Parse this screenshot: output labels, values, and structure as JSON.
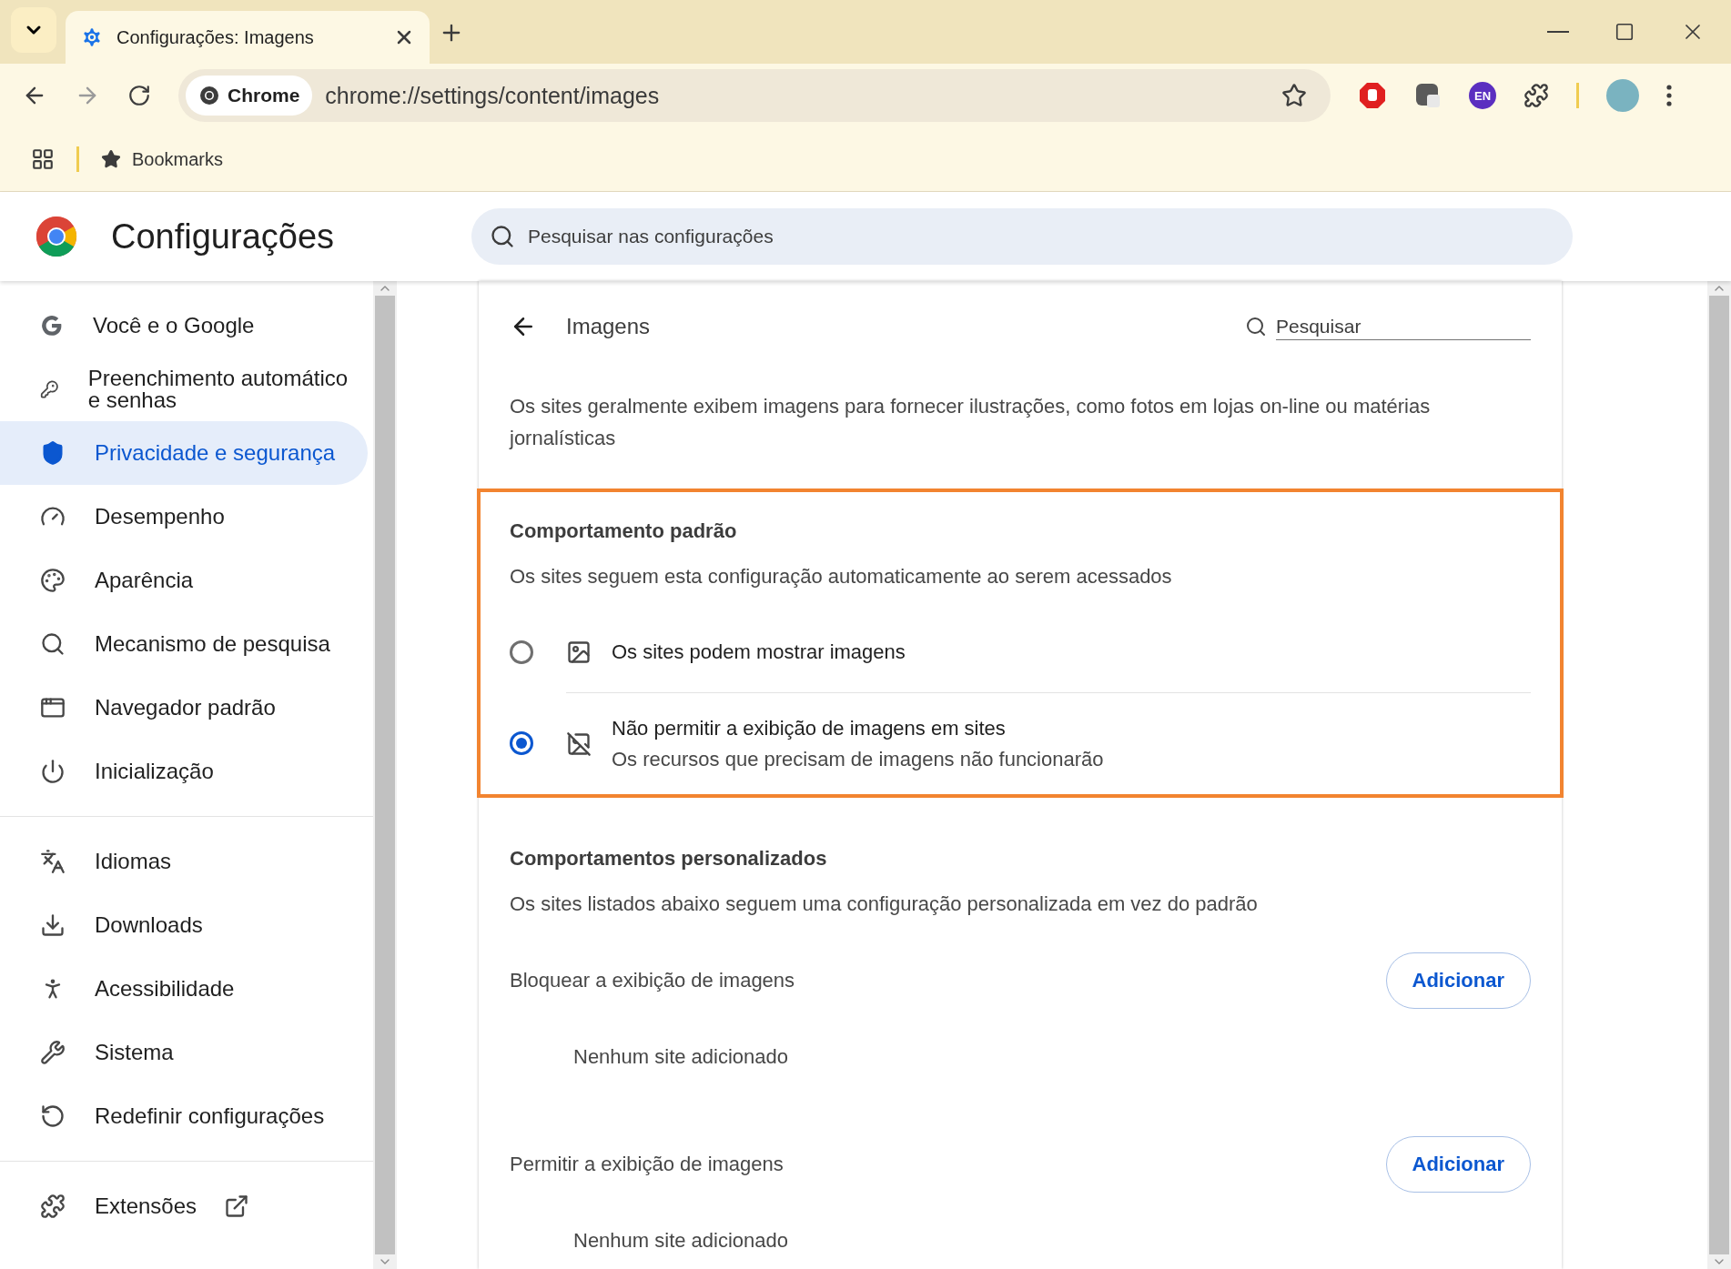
{
  "browser": {
    "tabs": [
      {
        "title": "Configurações: Imagens",
        "selected": true
      }
    ],
    "chip": "Chrome",
    "url": "chrome://settings/content/images",
    "extension_badge": "EN",
    "bookmarks": [
      "Bookmarks"
    ]
  },
  "header": {
    "title": "Configurações",
    "search_placeholder": "Pesquisar nas configurações"
  },
  "sidebar": {
    "groups": [
      [
        {
          "label": "Você e o Google",
          "selected": false
        },
        {
          "label": "Preenchimento automático e senhas",
          "selected": false
        },
        {
          "label": "Privacidade e segurança",
          "selected": true
        },
        {
          "label": "Desempenho",
          "selected": false
        },
        {
          "label": "Aparência",
          "selected": false
        },
        {
          "label": "Mecanismo de pesquisa",
          "selected": false
        },
        {
          "label": "Navegador padrão",
          "selected": false
        },
        {
          "label": "Inicialização",
          "selected": false
        }
      ],
      [
        {
          "label": "Idiomas",
          "selected": false
        },
        {
          "label": "Downloads",
          "selected": false
        },
        {
          "label": "Acessibilidade",
          "selected": false
        },
        {
          "label": "Sistema",
          "selected": false
        },
        {
          "label": "Redefinir configurações",
          "selected": false
        }
      ],
      [
        {
          "label": "Extensões",
          "selected": false,
          "external": true
        }
      ]
    ]
  },
  "page": {
    "title": "Imagens",
    "search_placeholder": "Pesquisar",
    "description": "Os sites geralmente exibem imagens para fornecer ilustrações, como fotos em lojas on-line ou matérias jornalísticas",
    "default_behavior": {
      "heading": "Comportamento padrão",
      "description": "Os sites seguem esta configuração automaticamente ao serem acessados",
      "highlighted": true,
      "options": [
        {
          "label": "Os sites podem mostrar imagens",
          "selected": false
        },
        {
          "label": "Não permitir a exibição de imagens em sites",
          "sublabel": "Os recursos que precisam de imagens não funcionarão",
          "selected": true
        }
      ]
    },
    "custom_behavior": {
      "heading": "Comportamentos personalizados",
      "description": "Os sites listados abaixo seguem uma configuração personalizada em vez do padrão",
      "sections": [
        {
          "label": "Bloquear a exibição de imagens",
          "button": "Adicionar",
          "empty": "Nenhum site adicionado"
        },
        {
          "label": "Permitir a exibição de imagens",
          "button": "Adicionar",
          "empty": "Nenhum site adicionado"
        }
      ]
    }
  }
}
